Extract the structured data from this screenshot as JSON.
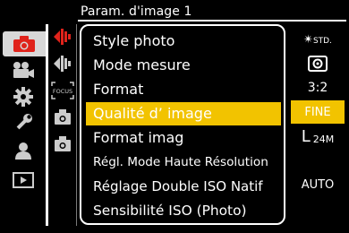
{
  "header": {
    "title": "Param. d'image 1"
  },
  "sidebar": {
    "items": [
      {
        "icon": "camera-icon",
        "active": true
      },
      {
        "icon": "video-camera-icon",
        "active": false
      },
      {
        "icon": "gear-icon",
        "active": false
      },
      {
        "icon": "wrench-icon",
        "active": false
      },
      {
        "icon": "person-icon",
        "active": false
      },
      {
        "icon": "playback-icon",
        "active": false
      }
    ]
  },
  "subtabs": {
    "items": [
      {
        "icon": "image-settings-icon"
      },
      {
        "icon": "image-settings-icon"
      },
      {
        "icon": "focus-icon",
        "label": "FOCUS"
      },
      {
        "icon": "camera-settings-icon"
      },
      {
        "icon": "camera-settings-icon"
      }
    ]
  },
  "menu": {
    "items": [
      {
        "label": "Style photo",
        "value": "STD.",
        "selected": false
      },
      {
        "label": "Mode mesure",
        "value": "",
        "selected": false
      },
      {
        "label": "Format",
        "value": "3:2",
        "selected": false
      },
      {
        "label": "Qualité d’ image",
        "value": "FINE",
        "selected": true
      },
      {
        "label": "Format imag",
        "value": "L 24M",
        "value_main": "L",
        "value_sub": "24M",
        "selected": false
      },
      {
        "label": "Régl. Mode Haute Résolution",
        "value": "",
        "selected": false
      },
      {
        "label": "Réglage Double ISO Natif",
        "value": "AUTO",
        "selected": false
      },
      {
        "label": "Sensibilité ISO (Photo)",
        "value": "",
        "selected": false
      }
    ]
  },
  "colors": {
    "highlight": "#f2c300",
    "active_tab": "#d8d8d8",
    "camera_red": "#e0231b",
    "arrow_red": "#e0231b"
  }
}
